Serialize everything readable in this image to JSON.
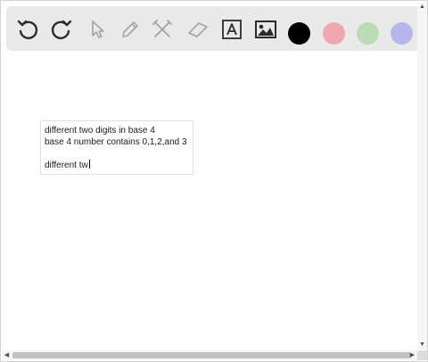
{
  "toolbar": {
    "tools": [
      {
        "name": "undo-icon"
      },
      {
        "name": "redo-icon"
      },
      {
        "name": "select-cursor-icon"
      },
      {
        "name": "pencil-icon"
      },
      {
        "name": "tools-icon"
      },
      {
        "name": "eraser-icon"
      },
      {
        "name": "text-tool-icon"
      },
      {
        "name": "image-icon"
      }
    ],
    "colors": [
      "#000000",
      "#f0a8b0",
      "#b9dcb4",
      "#b6b6ec"
    ]
  },
  "canvas": {
    "textbox": {
      "lines": [
        "different two digits in base 4",
        "base 4 number contains 0,1,2,and 3",
        "",
        "different tw"
      ]
    }
  },
  "scrollbars": {
    "up_arrow": "▲",
    "down_arrow": "▼",
    "left_arrow": "◀",
    "right_arrow": "▶"
  }
}
